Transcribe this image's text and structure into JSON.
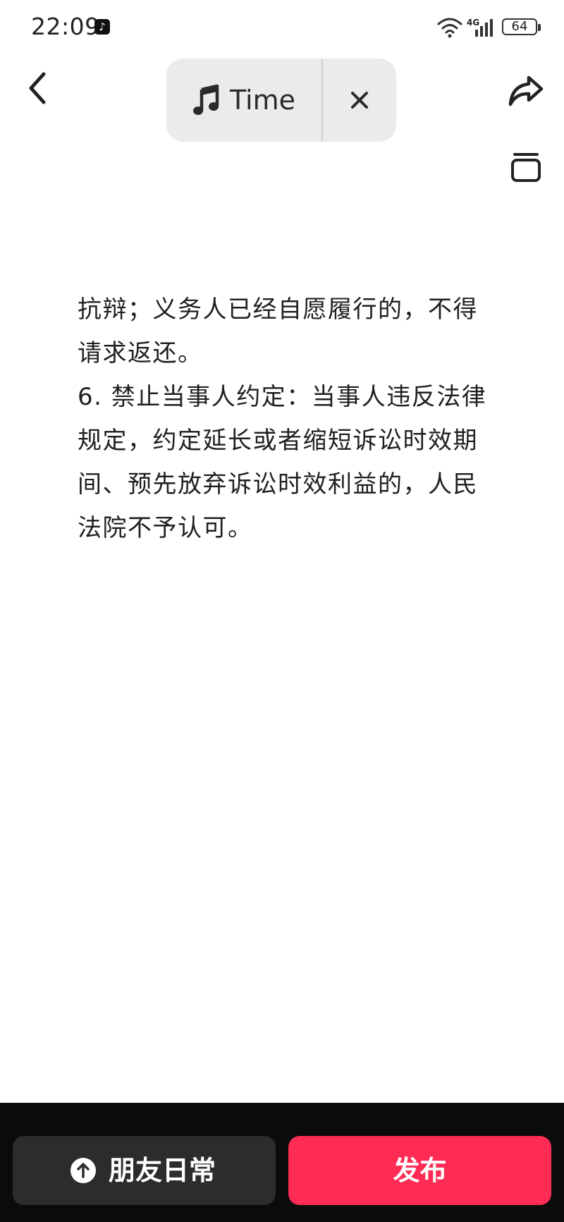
{
  "status_bar": {
    "time": "22:09",
    "network": "4G",
    "battery": "64",
    "icons": [
      "tiktok-icon",
      "wifi-icon",
      "signal-icon",
      "battery-icon"
    ]
  },
  "nav": {
    "icons": [
      "chevron-left-icon",
      "share-icon",
      "collection-icon"
    ]
  },
  "music": {
    "icon": "music-note-icon",
    "title": "Time",
    "close_icon": "close-icon"
  },
  "article": {
    "paragraphs": [
      "抗辩；义务人已经自愿履行的，不得请求返还。",
      "6. 禁止当事人约定：当事人违反法律规定，约定延长或者缩短诉讼时效期间、预先放弃诉讼时效利益的，人民法院不予认可。"
    ]
  },
  "bottom_bar": {
    "friends_label": "朋友日常",
    "friends_icon": "upload-icon",
    "publish_label": "发布",
    "publish_color": "#fe2c55"
  }
}
